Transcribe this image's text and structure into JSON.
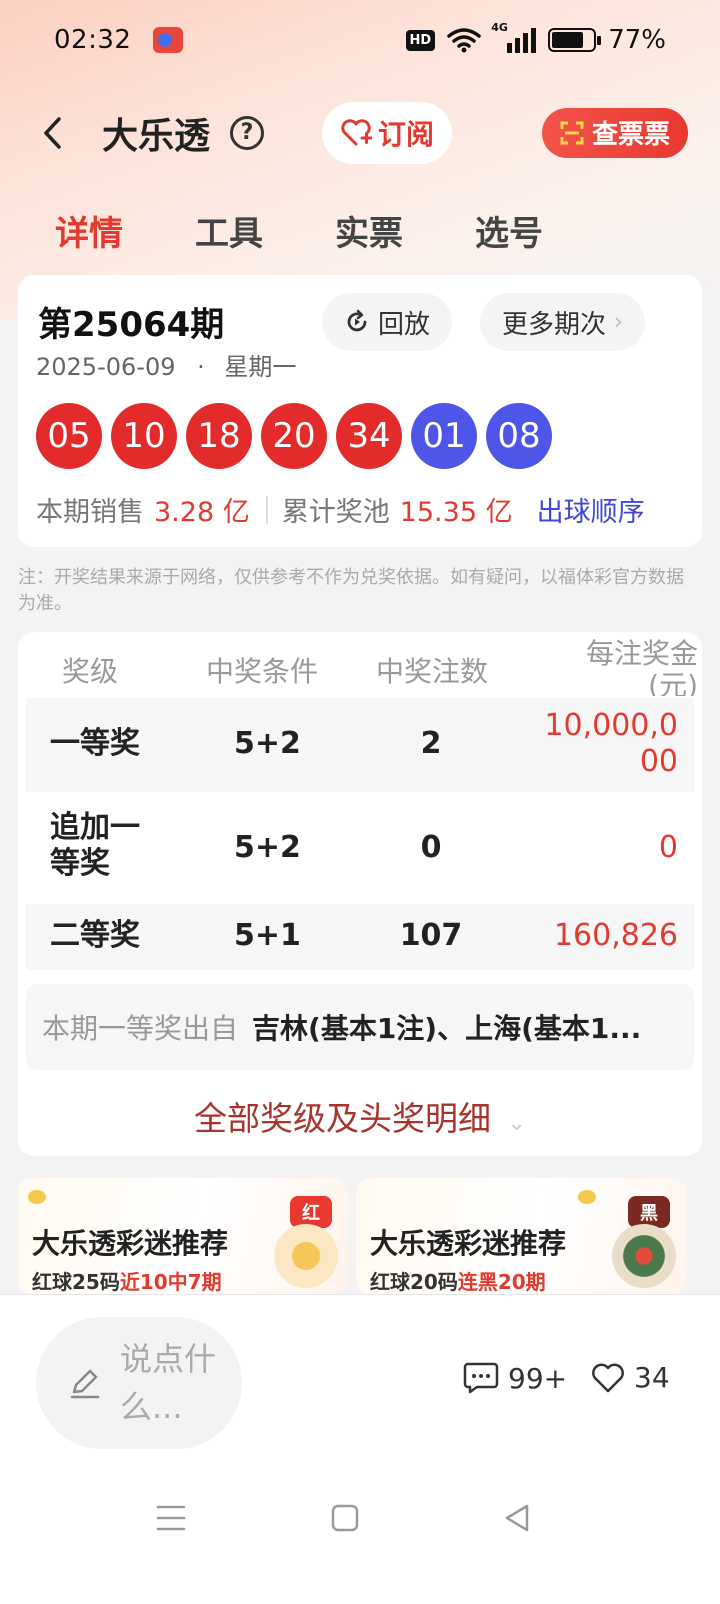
{
  "status_bar": {
    "time": "02:32",
    "hd": "HD",
    "network": "4G",
    "battery": "77%",
    "battery_level": 0.77
  },
  "header": {
    "title": "大乐透",
    "help": "?",
    "subscribe_label": "订阅",
    "check_ticket_label": "查票票"
  },
  "tabs": [
    {
      "label": "详情",
      "active": true
    },
    {
      "label": "工具",
      "active": false
    },
    {
      "label": "实票",
      "active": false
    },
    {
      "label": "选号",
      "active": false
    }
  ],
  "draw": {
    "issue": "第25064期",
    "date": "2025-06-09",
    "weekday_sep": "·",
    "weekday": "星期一",
    "replay_label": "回放",
    "more_issues_label": "更多期次",
    "red_balls": [
      "05",
      "10",
      "18",
      "20",
      "34"
    ],
    "blue_balls": [
      "01",
      "08"
    ],
    "sales_label": "本期销售",
    "sales_value": "3.28 亿",
    "pool_label": "累计奖池",
    "pool_value": "15.35 亿",
    "order_link": "出球顺序"
  },
  "note": "注：开奖结果来源于网络，仅供参考不作为兑奖依据。如有疑问，以福体彩官方数据为准。",
  "prize_table": {
    "headers": {
      "level": "奖级",
      "condition": "中奖条件",
      "count": "中奖注数",
      "amount": "每注奖金(元)"
    },
    "rows": [
      {
        "level": "一等奖",
        "condition": "5+2",
        "count": "2",
        "amount": "10,000,000"
      },
      {
        "level": "追加一等奖",
        "condition": "5+2",
        "count": "0",
        "amount": "0"
      },
      {
        "level": "二等奖",
        "condition": "5+1",
        "count": "107",
        "amount": "160,826"
      }
    ],
    "winners_label": "本期一等奖出自",
    "winners_value": "吉林(基本1注)、上海(基本1...",
    "all_prizes_link": "全部奖级及头奖明细"
  },
  "promos": [
    {
      "title": "大乐透彩迷推荐",
      "sub_prefix": "红球25码",
      "sub_highlight": "近10中7期",
      "tag": "红",
      "tag_color": "#e8382f"
    },
    {
      "title": "大乐透彩迷推荐",
      "sub_prefix": "红球20码",
      "sub_highlight": "连黑20期",
      "tag": "黑",
      "tag_color": "#7a2a22"
    }
  ],
  "bottom_bar": {
    "comment_placeholder": "说点什么...",
    "comments_count": "99+",
    "likes_count": "34"
  },
  "colors": {
    "accent": "#e33a30",
    "red_ball": "#e42b2b",
    "blue_ball": "#4e55e8",
    "link_blue": "#4048d8"
  }
}
